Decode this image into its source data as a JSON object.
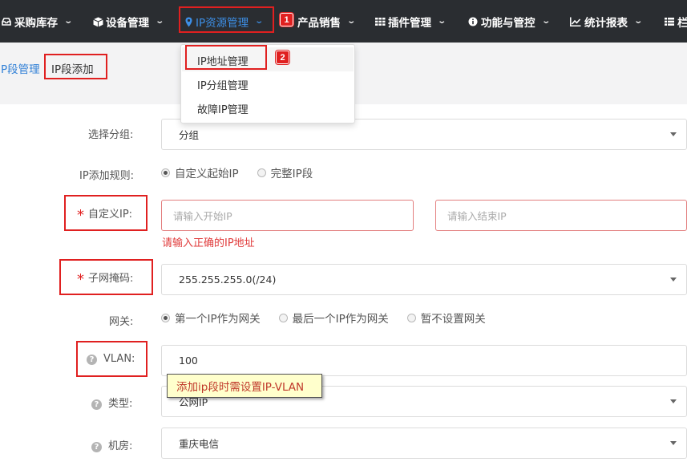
{
  "nav": {
    "items": [
      {
        "label": "采购库存",
        "icon": "inbox-icon"
      },
      {
        "label": "设备管理",
        "icon": "cube-icon"
      },
      {
        "label": "IP资源管理",
        "icon": "map-marker-icon"
      },
      {
        "label": "产品销售",
        "icon": "cart-icon"
      },
      {
        "label": "插件管理",
        "icon": "grid-icon"
      },
      {
        "label": "功能与管控",
        "icon": "info-circle-icon"
      },
      {
        "label": "统计报表",
        "icon": "line-chart-icon"
      },
      {
        "label": "栏",
        "icon": "list-icon"
      }
    ],
    "active_color": "#3d8fe6",
    "background": "#2a2d31"
  },
  "breadcrumb": {
    "parent": "IP段管理",
    "current": "IP段添加"
  },
  "dropdown": {
    "items": [
      "IP地址管理",
      "IP分组管理",
      "故障IP管理"
    ]
  },
  "annotations": {
    "badge1": "1",
    "badge2": "2"
  },
  "form": {
    "group": {
      "label": "选择分组:",
      "value": "分组"
    },
    "rule": {
      "label": "IP添加规则:",
      "options": [
        "自定义起始IP",
        "完整IP段"
      ],
      "selected": 0
    },
    "custom_ip": {
      "label": "自定义IP:",
      "start_placeholder": "请输入开始IP",
      "end_placeholder": "请输入结束IP",
      "error": "请输入正确的IP地址"
    },
    "mask": {
      "label": "子网掩码:",
      "value": "255.255.255.0(/24)"
    },
    "gateway": {
      "label": "网关:",
      "options": [
        "第一个IP作为网关",
        "最后一个IP作为网关",
        "暂不设置网关"
      ],
      "selected": 0
    },
    "vlan": {
      "label": "VLAN:",
      "value": "100",
      "tooltip": "添加ip段时需设置IP-VLAN"
    },
    "type": {
      "label": "类型:",
      "value": "公网IP"
    },
    "room": {
      "label": "机房:",
      "value": "重庆电信"
    }
  },
  "colors": {
    "error": "#e02020",
    "link": "#2f7fd6"
  }
}
